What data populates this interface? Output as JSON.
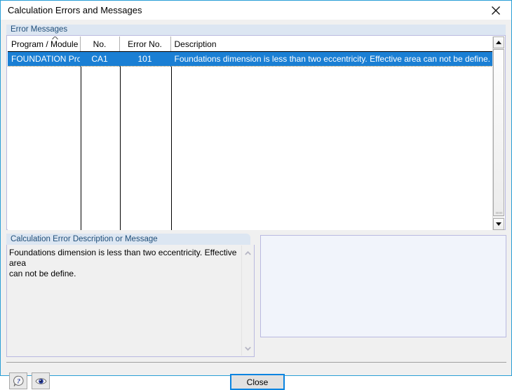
{
  "window": {
    "title": "Calculation Errors and Messages",
    "close_icon": "close-x-icon"
  },
  "error_messages_group": {
    "label": "Error Messages",
    "table": {
      "columns": [
        {
          "key": "program",
          "label": "Program / Module",
          "sorted": true,
          "sort_icon": "sort-ascending-caret"
        },
        {
          "key": "no",
          "label": "No."
        },
        {
          "key": "error_no",
          "label": "Error No."
        },
        {
          "key": "description",
          "label": "Description"
        }
      ],
      "rows": [
        {
          "selected": true,
          "program": "FOUNDATION Pro",
          "no": "CA1",
          "error_no": "101",
          "description": "Foundations dimension is less than two eccentricity. Effective area can not be define."
        }
      ]
    },
    "scrollbar": {
      "up_icon": "scroll-up-arrow-icon",
      "down_icon": "scroll-down-arrow-icon"
    }
  },
  "description_group": {
    "label": "Calculation Error Description or Message",
    "text": "Foundations dimension is less than two eccentricity. Effective area\ncan not be define.",
    "scrollbar": {
      "up_icon": "scroll-up-chevron-icon",
      "down_icon": "scroll-down-chevron-icon"
    }
  },
  "detail_panel": {
    "content": ""
  },
  "footer": {
    "help_button": {
      "icon": "help-question-bubble-icon",
      "label": ""
    },
    "view_button": {
      "icon": "eye-icon",
      "label": ""
    },
    "close_button": {
      "label": "Close"
    }
  },
  "colors": {
    "window_border": "#2a9fd6",
    "selection": "#1a7fd4",
    "group_label_bg": "#dce6f2",
    "group_label_text": "#1f4e79",
    "focus_border": "#0a84e0",
    "panel_bg": "#f1f4fb",
    "dialog_bg": "#f0f0f0"
  }
}
